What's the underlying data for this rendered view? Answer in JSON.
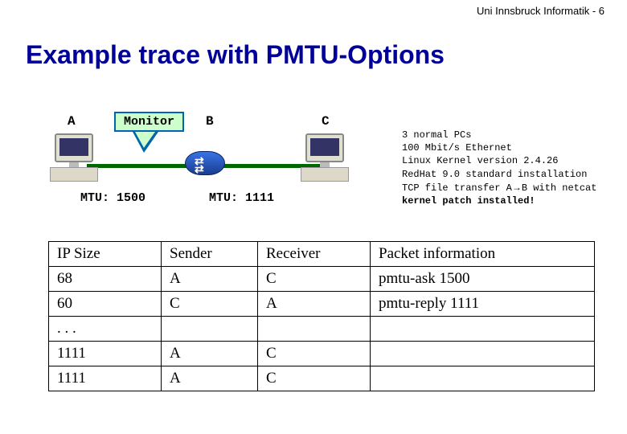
{
  "header": {
    "slide_number": "Uni Innsbruck Informatik - 6"
  },
  "title": "Example trace with PMTU-Options",
  "diagram": {
    "node_a": "A",
    "node_b": "B",
    "node_c": "C",
    "monitor_label": "Monitor",
    "mtu_left": "MTU: 1500",
    "mtu_right": "MTU: 1111"
  },
  "config": {
    "l1": "3 normal PCs",
    "l2": "100 Mbit/s Ethernet",
    "l3": "Linux Kernel version 2.4.26",
    "l4": "RedHat 9.0 standard installation",
    "l5a": "TCP file transfer A",
    "l5b": "B with netcat",
    "l6": "kernel patch installed!"
  },
  "table": {
    "h1": "IP Size",
    "h2": "Sender",
    "h3": "Receiver",
    "h4": "Packet information",
    "r1c1": "68",
    "r1c2": "A",
    "r1c3": "C",
    "r1c4": "pmtu-ask 1500",
    "r2c1": "60",
    "r2c2": "C",
    "r2c3": "A",
    "r2c4": "pmtu-reply 1111",
    "r3c1": ". . .",
    "r3c2": "",
    "r3c3": "",
    "r3c4": "",
    "r4c1": "1111",
    "r4c2": "A",
    "r4c3": "C",
    "r4c4": "",
    "r5c1": "1111",
    "r5c2": "A",
    "r5c3": "C",
    "r5c4": ""
  }
}
